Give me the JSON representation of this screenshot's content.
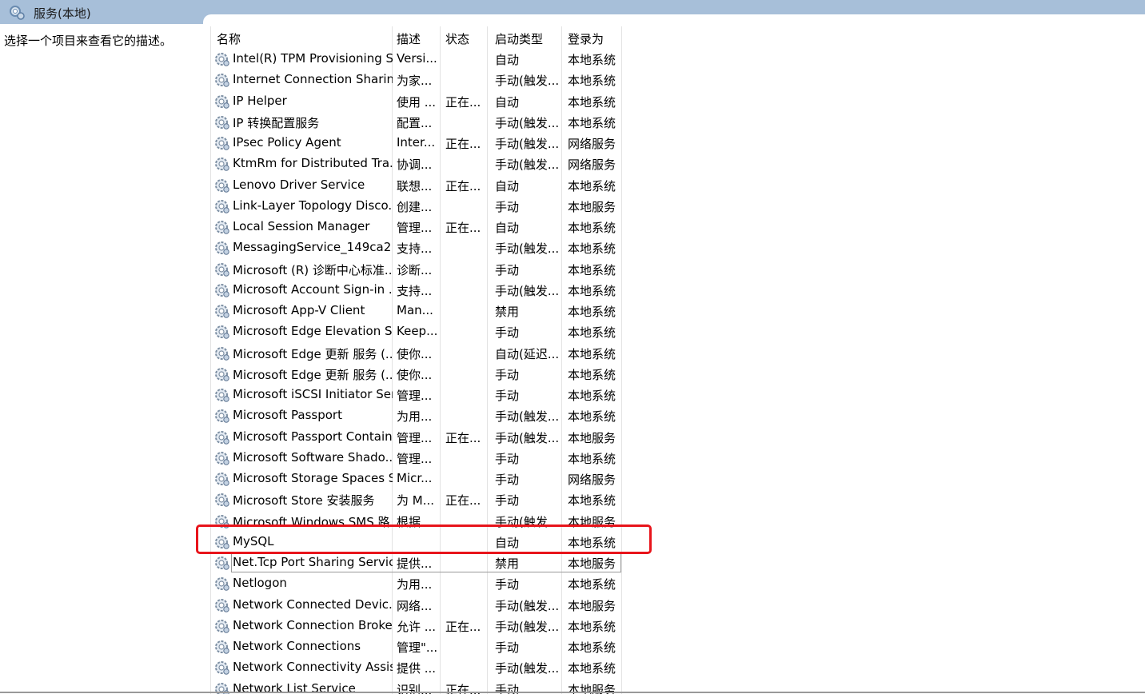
{
  "window": {
    "title": "服务(本地)",
    "icon": "services-gear-icon"
  },
  "left_pane": {
    "description": "选择一个项目来查看它的描述。"
  },
  "columns": {
    "name": "名称",
    "desc": "描述",
    "status": "状态",
    "startup": "启动类型",
    "logon": "登录为",
    "sort_indicator": "˄"
  },
  "services": [
    {
      "name": "Intel(R) TPM Provisioning S...",
      "desc": "Versi...",
      "status": "",
      "startup": "自动",
      "logon": "本地系统"
    },
    {
      "name": "Internet Connection Sharin...",
      "desc": "为家...",
      "status": "",
      "startup": "手动(触发...",
      "logon": "本地系统"
    },
    {
      "name": "IP Helper",
      "desc": "使用 ...",
      "status": "正在...",
      "startup": "自动",
      "logon": "本地系统"
    },
    {
      "name": "IP 转换配置服务",
      "desc": "配置...",
      "status": "",
      "startup": "手动(触发...",
      "logon": "本地系统"
    },
    {
      "name": "IPsec Policy Agent",
      "desc": "Inter...",
      "status": "正在...",
      "startup": "手动(触发...",
      "logon": "网络服务"
    },
    {
      "name": "KtmRm for Distributed Tra...",
      "desc": "协调...",
      "status": "",
      "startup": "手动(触发...",
      "logon": "网络服务"
    },
    {
      "name": "Lenovo Driver Service",
      "desc": "联想...",
      "status": "正在...",
      "startup": "自动",
      "logon": "本地系统"
    },
    {
      "name": "Link-Layer Topology Disco...",
      "desc": "创建...",
      "status": "",
      "startup": "手动",
      "logon": "本地服务"
    },
    {
      "name": "Local Session Manager",
      "desc": "管理...",
      "status": "正在...",
      "startup": "自动",
      "logon": "本地系统"
    },
    {
      "name": "MessagingService_149ca2",
      "desc": "支持...",
      "status": "",
      "startup": "手动(触发...",
      "logon": "本地系统"
    },
    {
      "name": "Microsoft (R) 诊断中心标准...",
      "desc": "诊断...",
      "status": "",
      "startup": "手动",
      "logon": "本地系统"
    },
    {
      "name": "Microsoft Account Sign-in ...",
      "desc": "支持...",
      "status": "",
      "startup": "手动(触发...",
      "logon": "本地系统"
    },
    {
      "name": "Microsoft App-V Client",
      "desc": "Man...",
      "status": "",
      "startup": "禁用",
      "logon": "本地系统"
    },
    {
      "name": "Microsoft Edge Elevation S...",
      "desc": "Keep...",
      "status": "",
      "startup": "手动",
      "logon": "本地系统"
    },
    {
      "name": "Microsoft Edge 更新 服务 (...",
      "desc": "使你...",
      "status": "",
      "startup": "自动(延迟...",
      "logon": "本地系统"
    },
    {
      "name": "Microsoft Edge 更新 服务 (...",
      "desc": "使你...",
      "status": "",
      "startup": "手动",
      "logon": "本地系统"
    },
    {
      "name": "Microsoft iSCSI Initiator Ser...",
      "desc": "管理...",
      "status": "",
      "startup": "手动",
      "logon": "本地系统"
    },
    {
      "name": "Microsoft Passport",
      "desc": "为用...",
      "status": "",
      "startup": "手动(触发...",
      "logon": "本地系统"
    },
    {
      "name": "Microsoft Passport Container",
      "desc": "管理...",
      "status": "正在...",
      "startup": "手动(触发...",
      "logon": "本地服务"
    },
    {
      "name": "Microsoft Software Shado...",
      "desc": "管理...",
      "status": "",
      "startup": "手动",
      "logon": "本地系统"
    },
    {
      "name": "Microsoft Storage Spaces S...",
      "desc": "Micr...",
      "status": "",
      "startup": "手动",
      "logon": "网络服务"
    },
    {
      "name": "Microsoft Store 安装服务",
      "desc": "为 M...",
      "status": "正在...",
      "startup": "手动",
      "logon": "本地系统"
    },
    {
      "name": "Microsoft Windows SMS 路...",
      "desc": "根据...",
      "status": "",
      "startup": "手动(触发...",
      "logon": "本地服务"
    },
    {
      "name": "MySQL",
      "desc": "",
      "status": "",
      "startup": "自动",
      "logon": "本地系统"
    },
    {
      "name": "Net.Tcp Port Sharing Service",
      "desc": "提供...",
      "status": "",
      "startup": "禁用",
      "logon": "本地服务"
    },
    {
      "name": "Netlogon",
      "desc": "为用...",
      "status": "",
      "startup": "手动",
      "logon": "本地系统"
    },
    {
      "name": "Network Connected Devic...",
      "desc": "网络...",
      "status": "",
      "startup": "手动(触发...",
      "logon": "本地服务"
    },
    {
      "name": "Network Connection Broker",
      "desc": "允许 ...",
      "status": "正在...",
      "startup": "手动(触发...",
      "logon": "本地系统"
    },
    {
      "name": "Network Connections",
      "desc": "管理\"...",
      "status": "",
      "startup": "手动",
      "logon": "本地系统"
    },
    {
      "name": "Network Connectivity Assis...",
      "desc": "提供 ...",
      "status": "",
      "startup": "手动(触发...",
      "logon": "本地系统"
    },
    {
      "name": "Network List Service",
      "desc": "识别...",
      "status": "正在...",
      "startup": "手动",
      "logon": "本地服务"
    }
  ],
  "colors": {
    "titlebar": "#a7bfd9",
    "highlight": "#e8141b"
  }
}
